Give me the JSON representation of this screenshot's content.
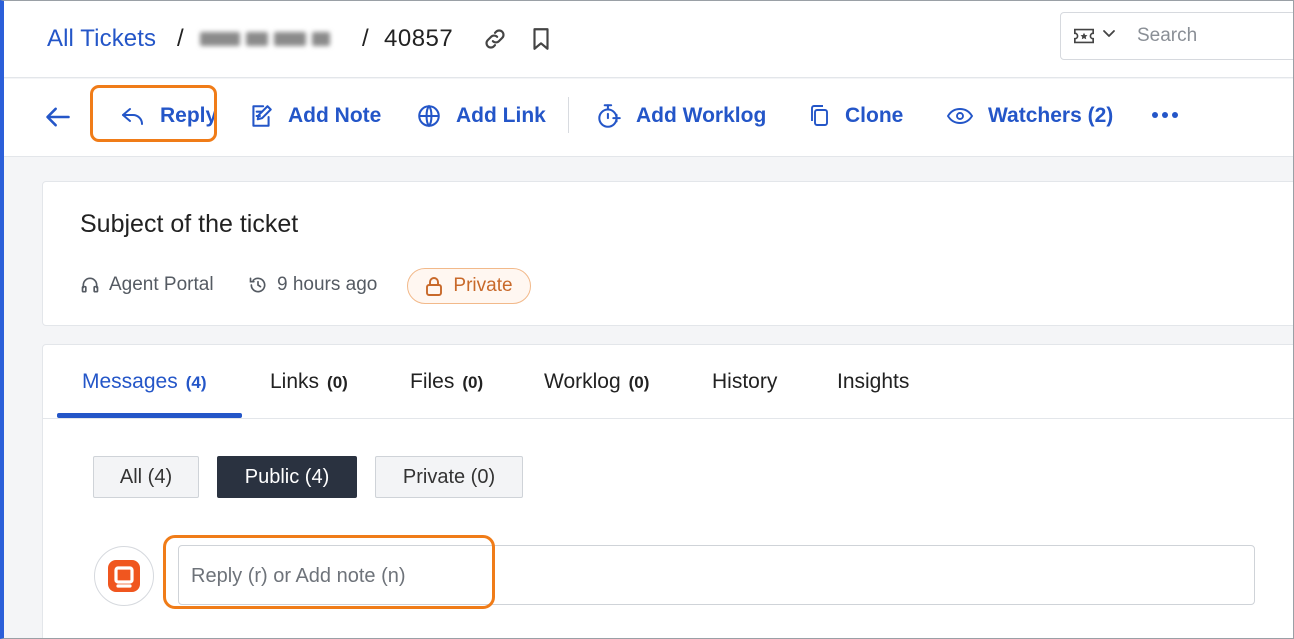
{
  "breadcrumb": {
    "root": "All Tickets",
    "separator": "/",
    "ticket_id": "40857"
  },
  "search": {
    "placeholder": "Search"
  },
  "toolbar": {
    "reply_label": "Reply",
    "add_note_label": "Add Note",
    "add_link_label": "Add Link",
    "add_worklog_label": "Add Worklog",
    "clone_label": "Clone",
    "watchers_label": "Watchers (2)"
  },
  "ticket": {
    "subject": "Subject of the ticket",
    "source": "Agent Portal",
    "updated": "9 hours ago",
    "visibility": "Private"
  },
  "tabs": [
    {
      "label": "Messages",
      "count": "(4)"
    },
    {
      "label": "Links",
      "count": "(0)"
    },
    {
      "label": "Files",
      "count": "(0)"
    },
    {
      "label": "Worklog",
      "count": "(0)"
    },
    {
      "label": "History",
      "count": ""
    },
    {
      "label": "Insights",
      "count": ""
    }
  ],
  "filters": [
    {
      "label": "All (4)"
    },
    {
      "label": "Public (4)"
    },
    {
      "label": "Private (0)"
    }
  ],
  "composer": {
    "placeholder": "Reply (r) or Add note (n)"
  },
  "colors": {
    "accent": "#2456c8",
    "highlight": "#f07c18",
    "avatar_brand": "#f0561f",
    "active_filter": "#2a3240"
  }
}
